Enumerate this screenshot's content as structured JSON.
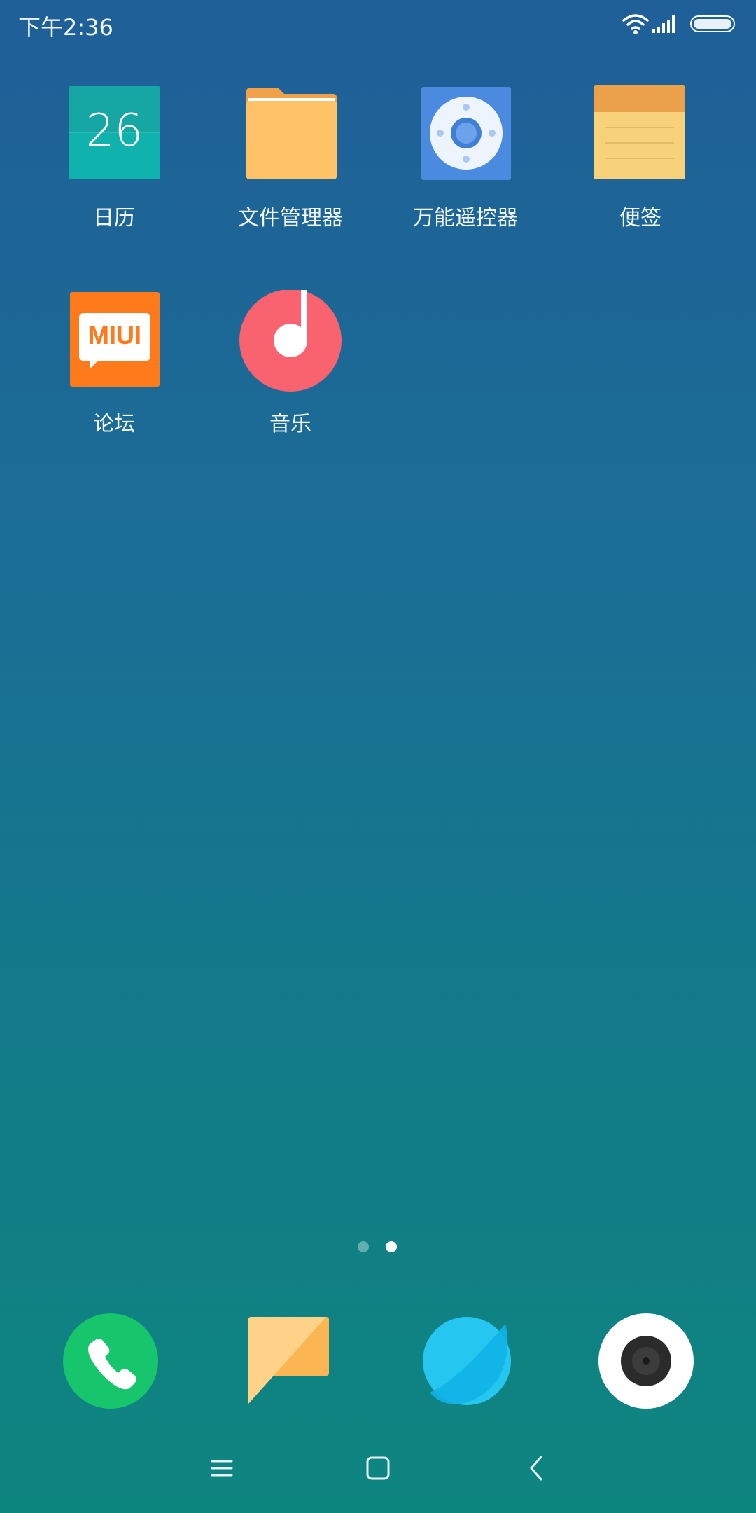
{
  "status_bar": {
    "time": "下午2:36",
    "icons": [
      "wifi-icon",
      "signal-icon",
      "battery-icon"
    ]
  },
  "apps": [
    {
      "name": "calendar",
      "label": "日历",
      "icon_text": "26",
      "icon": "calendar-icon"
    },
    {
      "name": "file-manager",
      "label": "文件管理器",
      "icon": "folder-icon"
    },
    {
      "name": "remote-control",
      "label": "万能遥控器",
      "icon": "remote-control-icon"
    },
    {
      "name": "notes",
      "label": "便签",
      "icon": "notes-icon"
    },
    {
      "name": "forum",
      "label": "论坛",
      "icon_text": "MIUI",
      "icon": "miui-forum-icon"
    },
    {
      "name": "music",
      "label": "音乐",
      "icon": "music-icon"
    }
  ],
  "page_indicator": {
    "pages": 2,
    "current": 2
  },
  "dock": [
    {
      "name": "phone",
      "icon": "phone-icon"
    },
    {
      "name": "messages",
      "icon": "message-icon"
    },
    {
      "name": "browser",
      "icon": "browser-icon"
    },
    {
      "name": "camera",
      "icon": "camera-icon"
    }
  ],
  "navbar": [
    "menu-icon",
    "home-icon",
    "back-icon"
  ],
  "colors": {
    "background_top": "#1f5f98",
    "background_bottom": "#0e8680",
    "calendar": "#0fb2ad",
    "folder": "#ffc266",
    "remote": "#4a8be0",
    "notes_top": "#eba14a",
    "notes_body": "#f7d27a",
    "forum": "#ff7a1a",
    "music": "#f9636f",
    "phone": "#16c56c",
    "browser": "#25c6ef"
  }
}
